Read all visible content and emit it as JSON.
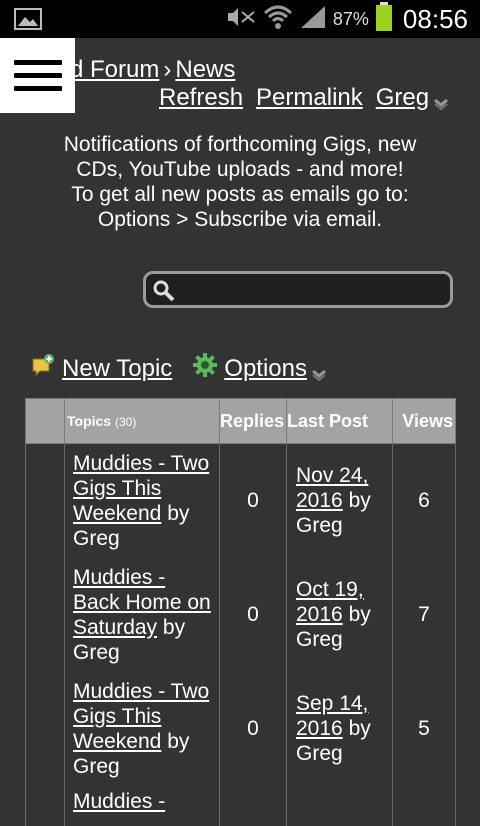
{
  "status_bar": {
    "battery_pct": "87%",
    "time": "08:56",
    "icons": [
      "image-icon",
      "mute-icon",
      "wifi-icon",
      "signal-icon",
      "battery-icon"
    ]
  },
  "breadcrumb": {
    "forum": "d Forum",
    "separator": "›",
    "current": "News"
  },
  "top_links": {
    "refresh": "Refresh",
    "permalink": "Permalink",
    "user": "Greg"
  },
  "notice": {
    "line1": "Notifications of forthcoming Gigs, new",
    "line2": "CDs, YouTube uploads - and more!",
    "line3": "To get all new posts as emails go to:",
    "line4": "Options > Subscribe via email."
  },
  "search": {
    "value": "",
    "placeholder": ""
  },
  "actions": {
    "new_topic": "New Topic",
    "options": "Options"
  },
  "table": {
    "headers": {
      "topics": "Topics",
      "topics_count": "(30)",
      "replies": "Replies",
      "last_post": "Last Post",
      "views": "Views"
    },
    "rows": [
      {
        "title": "Muddies - Two Gigs This Weekend",
        "by": "by",
        "author": "Greg",
        "replies": "0",
        "last_date": "Nov 24, 2016",
        "last_by": "by",
        "last_author": "Greg",
        "views": "6"
      },
      {
        "title": "Muddies - Back Home on Saturday",
        "by": "by",
        "author": "Greg",
        "replies": "0",
        "last_date": "Oct 19, 2016",
        "last_by": "by",
        "last_author": "Greg",
        "views": "7"
      },
      {
        "title": "Muddies - Two Gigs This Weekend",
        "by": "by",
        "author": "Greg",
        "replies": "0",
        "last_date": "Sep 14, 2016",
        "last_by": "by",
        "last_author": "Greg",
        "views": "5"
      },
      {
        "title": "Muddies -",
        "by": "",
        "author": "",
        "replies": "",
        "last_date": "",
        "last_by": "",
        "last_author": "",
        "views": ""
      }
    ]
  },
  "colors": {
    "background": "#333333",
    "header_bg": "#a3a3a3",
    "battery": "#9bd41f"
  }
}
